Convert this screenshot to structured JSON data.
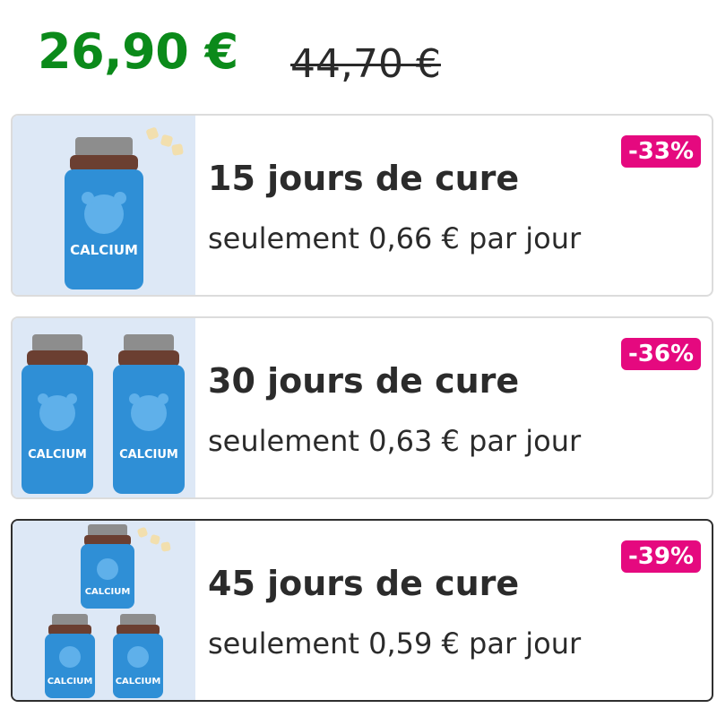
{
  "price": {
    "current": "26,90 €",
    "original": "44,70 €"
  },
  "options": [
    {
      "title": "15 jours de cure",
      "subtitle": "seulement 0,66 € par jour",
      "discount": "-33%",
      "product_label": "CALCIUM",
      "bottles": 1,
      "selected": false
    },
    {
      "title": "30 jours de cure",
      "subtitle": "seulement 0,63 € par jour",
      "discount": "-36%",
      "product_label": "CALCIUM",
      "bottles": 2,
      "selected": false
    },
    {
      "title": "45 jours de cure",
      "subtitle": "seulement 0,59 € par jour",
      "discount": "-39%",
      "product_label": "CALCIUM",
      "bottles": 3,
      "selected": true
    }
  ],
  "colors": {
    "price_green": "#0b8a1a",
    "badge_pink": "#e5097f",
    "bottle_blue": "#2f8fd6",
    "card_image_bg": "#dde8f6"
  }
}
